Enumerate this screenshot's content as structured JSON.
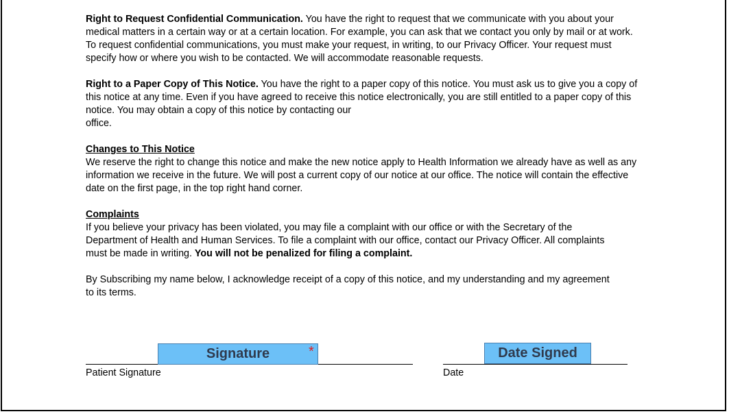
{
  "sections": {
    "confidential": {
      "heading": "Right to Request Confidential Communication.",
      "body": " You have the right to request that we communicate with you about your medical matters in a certain way or at a certain location. For example, you can ask that we contact you only by mail or at work. To request confidential communications, you must make your request, in writing, to our Privacy Officer. Your request must specify how or where you wish to be contacted. We will accommodate reasonable requests."
    },
    "paper_copy": {
      "heading": "Right to a Paper Copy of This Notice.",
      "body": " You have the right to a paper copy of this notice. You must ask us to give you a copy of this notice at any time. Even if you have agreed to receive this notice electronically, you are still entitled to a paper copy of this notice. You may obtain a copy of this notice by contacting our",
      "body_tail": "office."
    },
    "changes": {
      "heading": "Changes to This Notice",
      "body": "We reserve the right to change this notice and make the new notice apply to Health Information we already have as well as any information we receive in the future. We will post a current copy of our notice at our office. The notice will contain the effective date on the first page, in the top right hand corner."
    },
    "complaints": {
      "heading": "Complaints",
      "body": "If you believe your privacy has been violated, you may file a complaint with our office or with the Secretary of the Department of Health and Human Services. To file a complaint with our office, contact our Privacy Officer. All complaints must be made in writing. ",
      "bold_tail": "You will not be penalized for filing a complaint."
    },
    "acknowledge": {
      "body": "By Subscribing my name below, I acknowledge receipt of a copy of this notice, and my understanding and my agreement to its terms."
    }
  },
  "signature_block": {
    "signature_field_label": "Signature",
    "required_marker": "*",
    "signature_caption": "Patient Signature",
    "date_field_label": "Date Signed",
    "date_caption": "Date"
  },
  "colors": {
    "field_fill": "#6cc0f7",
    "field_text": "#2f3a4d",
    "required": "#e02020"
  }
}
